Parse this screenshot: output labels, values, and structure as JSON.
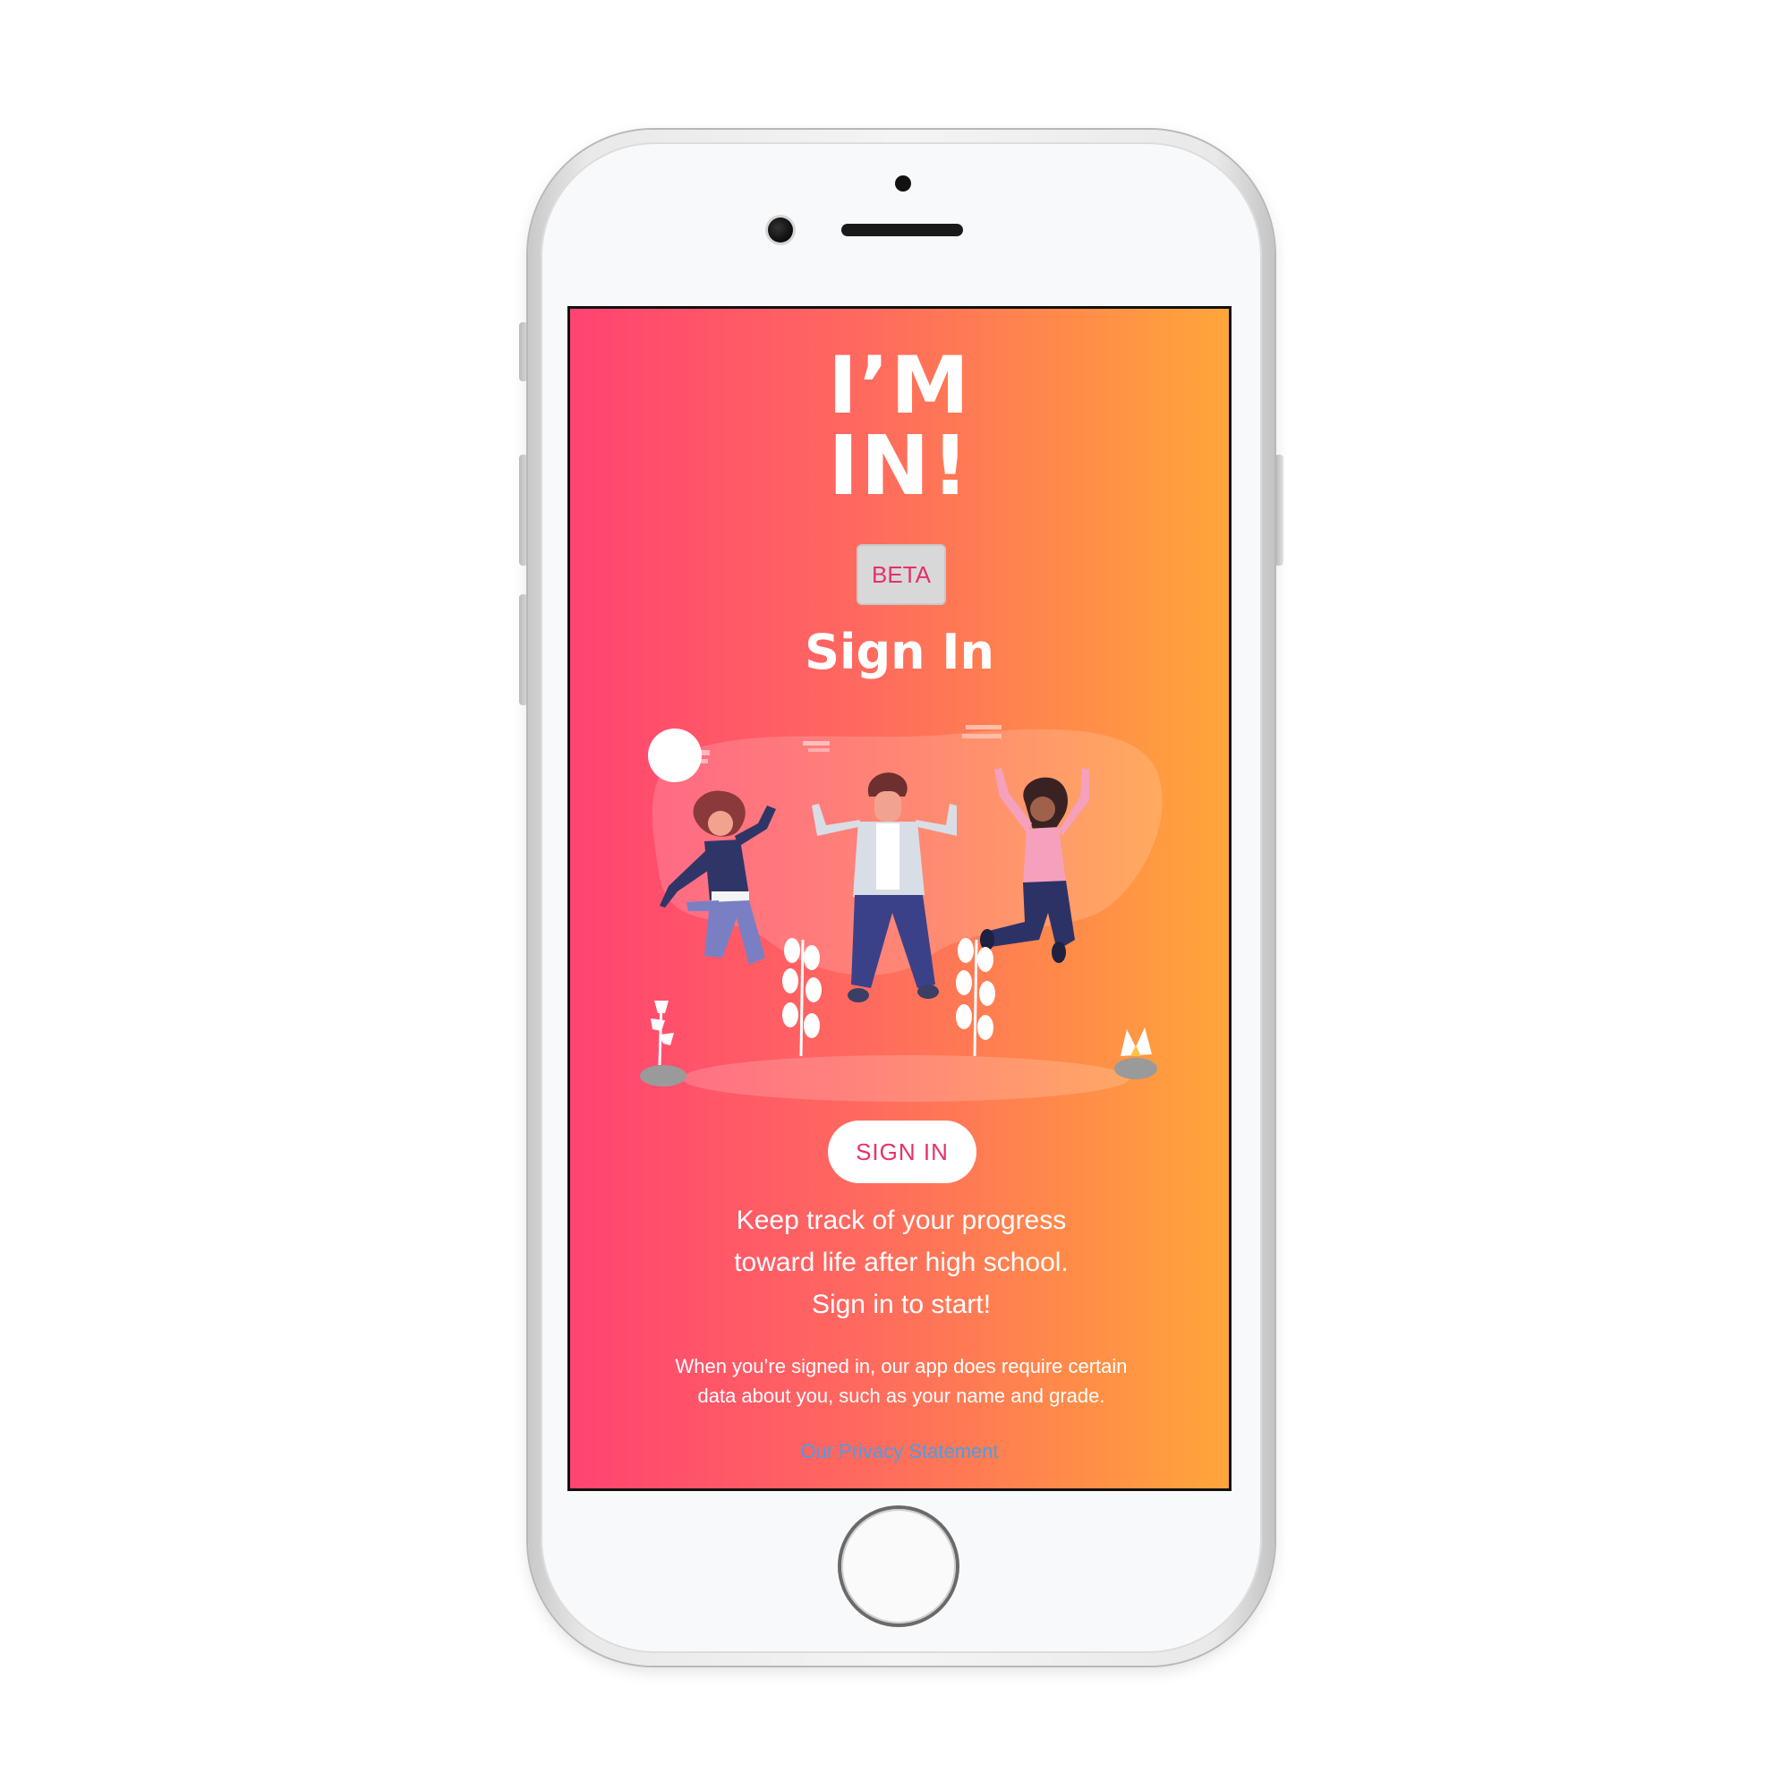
{
  "app": {
    "logo_line1": "I’M",
    "logo_line2": "IN!",
    "badge": "BETA",
    "title": "Sign In"
  },
  "actions": {
    "sign_in_button": "SIGN IN"
  },
  "tagline": {
    "line1": "Keep track of your progress",
    "line2": "toward life after high school.",
    "line3": "Sign in to start!"
  },
  "notice": {
    "text": "When you’re signed in, our app does require certain data about you, such as your name and grade.",
    "privacy_link": "Our Privacy Statement"
  },
  "colors": {
    "gradient_left": "#ff4373",
    "gradient_right": "#ffa63a",
    "accent": "#e9306a",
    "link": "#4a9de6"
  },
  "icons": [
    "people-jumping-illustration",
    "home-button",
    "front-camera"
  ]
}
